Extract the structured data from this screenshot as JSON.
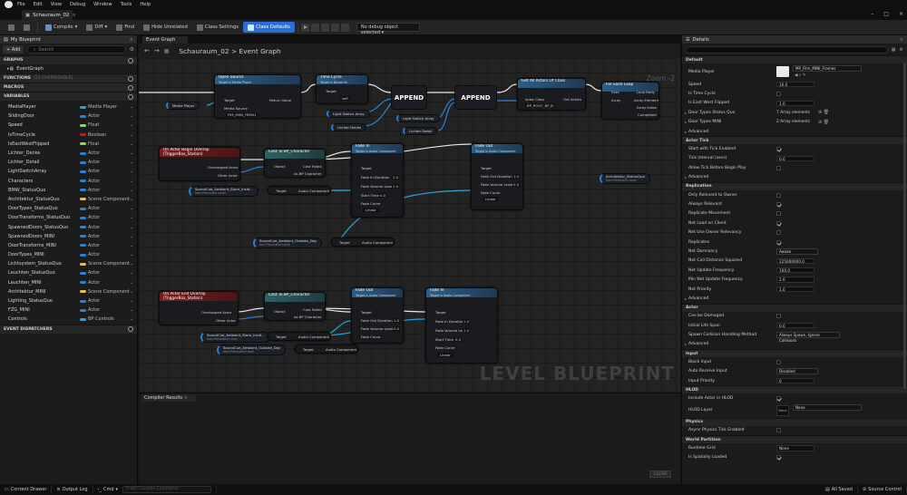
{
  "menu": [
    "File",
    "Edit",
    "View",
    "Debug",
    "Window",
    "Tools",
    "Help"
  ],
  "doc_tab": "Schauraum_02",
  "toolbar": {
    "compile": "Compile",
    "diff": "Diff",
    "find": "Find",
    "hide": "Hide Unrelated",
    "class_settings": "Class Settings",
    "class_defaults": "Class Defaults",
    "debug": "No debug object selected"
  },
  "left": {
    "title": "My Blueprint",
    "add": "Add",
    "search": "Search",
    "graphs": "GRAPHS",
    "event_graph": "EventGraph",
    "functions": "FUNCTIONS",
    "functions_sub": "(23 OVERRIDABLE)",
    "macros": "MACROS",
    "variables": "VARIABLES",
    "dispatchers": "EVENT DISPATCHERS",
    "vars": [
      {
        "name": "MediaPlayer",
        "type": "Media Player",
        "color": "#2aa3d6"
      },
      {
        "name": "SlidingDoor",
        "type": "Actor",
        "color": "#2d7fd6"
      },
      {
        "name": "Speed",
        "type": "Float",
        "color": "#8fdc4a"
      },
      {
        "name": "IsTimeCycle",
        "type": "Boolean",
        "color": "#c41a1a"
      },
      {
        "name": "IsEastWestFlipped",
        "type": "Float",
        "color": "#8fdc4a"
      },
      {
        "name": "Lichter_Decke",
        "type": "Actor",
        "color": "#2d7fd6"
      },
      {
        "name": "Lichter_Detail",
        "type": "Actor",
        "color": "#2d7fd6"
      },
      {
        "name": "LightSwitchArray",
        "type": "Actor",
        "color": "#2d7fd6"
      },
      {
        "name": "Characters",
        "type": "Actor",
        "color": "#2d7fd6"
      },
      {
        "name": "BMW_StatusQuo",
        "type": "Actor",
        "color": "#2d7fd6"
      },
      {
        "name": "Architektur_StatusQuo",
        "type": "Scene Component",
        "color": "#e8c04a"
      },
      {
        "name": "DoorTypes_StatusQuo",
        "type": "Actor",
        "color": "#2d7fd6"
      },
      {
        "name": "DoorTransforms_StatusQuo",
        "type": "Actor",
        "color": "#2d7fd6"
      },
      {
        "name": "SpawnedDoors_StatusQuo",
        "type": "Actor",
        "color": "#2d7fd6"
      },
      {
        "name": "SpawnedDoors_MINI",
        "type": "Actor",
        "color": "#2d7fd6"
      },
      {
        "name": "DoorTransforms_MINI",
        "type": "Actor",
        "color": "#2d7fd6"
      },
      {
        "name": "DoorTypes_MINI",
        "type": "Actor",
        "color": "#2d7fd6"
      },
      {
        "name": "Lichtsystem_StatusQuo",
        "type": "Scene Component",
        "color": "#e8c04a"
      },
      {
        "name": "Leuchten_StatusQuo",
        "type": "Actor",
        "color": "#2d7fd6"
      },
      {
        "name": "Leuchten_MINI",
        "type": "Actor",
        "color": "#2d7fd6"
      },
      {
        "name": "Architektur_MINI",
        "type": "Scene Component",
        "color": "#e8c04a"
      },
      {
        "name": "Lighting_StatusQuo",
        "type": "Actor",
        "color": "#2d7fd6"
      },
      {
        "name": "FZG_MINI",
        "type": "Actor",
        "color": "#2d7fd6"
      },
      {
        "name": "Controls",
        "type": "BP Controls",
        "color": "#2aa3d6"
      }
    ]
  },
  "graph": {
    "tab": "Event Graph",
    "crumb_root": "Schauraum_02",
    "crumb_sep": ">",
    "crumb_leaf": "Event Graph",
    "zoom": "Zoom -2",
    "watermark": "LEVEL BLUEPRINT",
    "nodes": {
      "open_source": {
        "title": "Open Source",
        "sub": "Target is Media Player",
        "target": "Target",
        "return": "Return Value",
        "media_source": "Media Source",
        "media_val": "FIM_MINI_FRM01"
      },
      "media_player": "Media Player",
      "time_cycle": {
        "title": "Time Cycle",
        "sub": "Target is Blueprint",
        "target": "Target",
        "val": "self"
      },
      "light_switch": "Light Switch Array",
      "lichter_decke": "Lichter Decke",
      "light_switch2": "Light Switch Array",
      "lichter_detail": "Lichter Detail",
      "append": "APPEND",
      "get_all": {
        "title": "Get All Actors Of Class",
        "actor_class": "Actor Class",
        "class_val": "BP_ROOF_BP_B",
        "out": "Out Actors"
      },
      "for_each": {
        "title": "For Each Loop",
        "exec": "Exec",
        "array": "Array",
        "loop_body": "Loop Body",
        "array_element": "Array Element",
        "array_index": "Array Index",
        "completed": "Completed"
      },
      "arch_sq": "Architektur_StatusQuo",
      "arch_sq_sub": "from Persistent Level",
      "begin": {
        "title": "On Actor Begin Overlap (TriggerBox_Station)",
        "overlapped": "Overlapped Actor",
        "other": "Other Actor"
      },
      "cast1": {
        "title": "Cast To BP_Character",
        "object": "Object",
        "cast_failed": "Cast Failed",
        "as": "As BP Character"
      },
      "fadein1": {
        "title": "Fade In",
        "sub": "Target is Audio Component",
        "target": "Target",
        "dur": "Fade In Duration",
        "dur_v": "1.0",
        "vol": "Fade Volume Level",
        "vol_v": "1.0",
        "start": "Start Time",
        "start_v": "0.0",
        "curve": "Fade Curve",
        "curve_v": "Linear"
      },
      "fadeout1": {
        "title": "Fade Out",
        "sub": "Target is Audio Component",
        "target": "Target",
        "dur": "Fade Out Duration",
        "dur_v": "1.0",
        "vol": "Fade Volume Level",
        "vol_v": "0.0",
        "curve": "Fade Curve",
        "curve_v": "Linear"
      },
      "ambient_sq": "SoundCue_Ambient_Store_Insid...",
      "ambient_sub": "from Persistent Level",
      "ambient_out": "SoundCue_Ambient_Outside_Day",
      "target": "Target",
      "audio_comp": "Audio Component",
      "end": {
        "title": "On Actor End Overlap (TriggerBox_Station)",
        "overlapped": "Overlapped Actor",
        "other": "Other Actor"
      },
      "fadeout2": {
        "title": "Fade Out",
        "sub": "Target is Audio Component",
        "target": "Target",
        "dur": "Fade Out Duration",
        "dur_v": "1.0",
        "vol": "Fade Volume Level",
        "vol_v": "0.0",
        "curve": "Fade Curve",
        "curve_v": "Linear"
      },
      "fadein2": {
        "title": "Fade In",
        "sub": "Target is Audio Component",
        "target": "Target",
        "dur": "Fade In Duration",
        "dur_v": "1.0",
        "vol": "Fade Volume Level",
        "vol_v": "1.0",
        "start": "Start Time",
        "start_v": "0.0",
        "curve": "Fade Curve",
        "curve_v": "Linear"
      }
    }
  },
  "compiler": {
    "tab": "Compiler Results",
    "clear": "CLEAR"
  },
  "details": {
    "title": "Details",
    "search": "Search",
    "default": "Default",
    "media_player": "Media Player",
    "media_val": "MP_Film_MINI_Frames",
    "speed": "Speed",
    "speed_v": "10.0",
    "is_time_cycle": "Is Time Cycle",
    "east_west": "Is East West Flipped",
    "east_west_v": "1.0",
    "door_sq": "Door Types Status Quo",
    "door_sq_v": "7 Array elements",
    "door_mini": "Door Types MINI",
    "door_mini_v": "2 Array elements",
    "advanced": "Advanced",
    "actor_tick": "Actor Tick",
    "start_tick": "Start with Tick Enabled",
    "tick_interval": "Tick Interval (secs)",
    "tick_interval_v": "0.0",
    "allow_tick": "Allow Tick Before Begin Play",
    "replication": "Replication",
    "only_owner": "Only Relevant to Owner",
    "always_rel": "Always Relevant",
    "repl_move": "Replicate Movement",
    "net_load": "Net Load on Client",
    "net_owner": "Net Use Owner Relevancy",
    "replicates": "Replicates",
    "net_dormancy": "Net Dormancy",
    "net_dormancy_v": "Awake",
    "net_cull": "Net Cull Distance Squared",
    "net_cull_v": "225000000.0",
    "net_update": "Net Update Frequency",
    "net_update_v": "100.0",
    "min_net": "Min Net Update Frequency",
    "min_net_v": "2.0",
    "net_priority": "Net Priority",
    "net_priority_v": "1.0",
    "actor": "Actor",
    "can_damaged": "Can be Damaged",
    "initial_life": "Initial Life Span",
    "initial_life_v": "0.0",
    "spawn_coll": "Spawn Collision Handling Method",
    "spawn_coll_v": "Always Spawn, Ignore Collisions",
    "input": "Input",
    "block_input": "Block Input",
    "auto_input": "Auto Receive Input",
    "auto_input_v": "Disabled",
    "input_priority": "Input Priority",
    "input_priority_v": "0",
    "hlod": "HLOD",
    "include_hlod": "Include Actor in HLOD",
    "hlod_layer": "HLOD Layer",
    "hlod_none": "None",
    "hlod_dd": "None",
    "physics": "Physics",
    "async_tick": "Async Physics Tick Enabled",
    "world_partition": "World Partition",
    "runtime_grid": "Runtime Grid",
    "runtime_grid_v": "None",
    "spatially": "Is Spatially Loaded"
  },
  "status": {
    "content_drawer": "Content Drawer",
    "output_log": "Output Log",
    "cmd": "Cmd",
    "console": "Enter Console Command",
    "all_saved": "All Saved",
    "source_control": "Source Control"
  }
}
